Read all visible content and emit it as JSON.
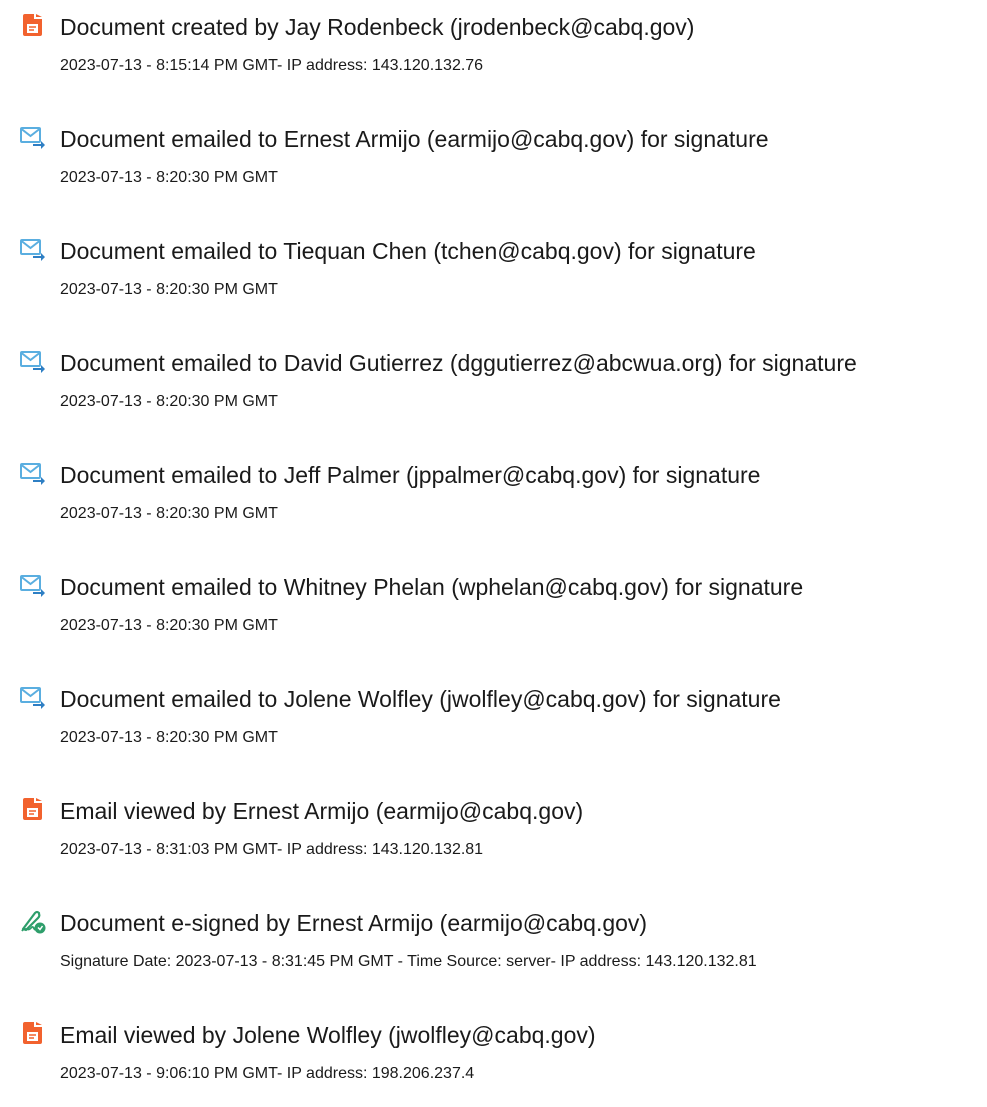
{
  "colors": {
    "created_icon": "#f2622e",
    "email_icon": "#5aaee0",
    "sign_icon": "#2e9e6b",
    "text": "#1a1a1a"
  },
  "events": [
    {
      "icon": "document-created-icon",
      "title": "Document created by Jay Rodenbeck (jrodenbeck@cabq.gov)",
      "detail": "2023-07-13 - 8:15:14 PM GMT- IP address: 143.120.132.76"
    },
    {
      "icon": "email-sent-icon",
      "title": "Document emailed to Ernest Armijo (earmijo@cabq.gov) for signature",
      "detail": "2023-07-13 - 8:20:30 PM GMT"
    },
    {
      "icon": "email-sent-icon",
      "title": "Document emailed to Tiequan Chen (tchen@cabq.gov) for signature",
      "detail": "2023-07-13 - 8:20:30 PM GMT"
    },
    {
      "icon": "email-sent-icon",
      "title": "Document emailed to David Gutierrez (dggutierrez@abcwua.org) for signature",
      "detail": "2023-07-13 - 8:20:30 PM GMT"
    },
    {
      "icon": "email-sent-icon",
      "title": "Document emailed to Jeff Palmer (jppalmer@cabq.gov) for signature",
      "detail": "2023-07-13 - 8:20:30 PM GMT"
    },
    {
      "icon": "email-sent-icon",
      "title": "Document emailed to Whitney Phelan (wphelan@cabq.gov) for signature",
      "detail": "2023-07-13 - 8:20:30 PM GMT"
    },
    {
      "icon": "email-sent-icon",
      "title": "Document emailed to Jolene Wolfley (jwolfley@cabq.gov) for signature",
      "detail": "2023-07-13 - 8:20:30 PM GMT"
    },
    {
      "icon": "document-viewed-icon",
      "title": "Email viewed by Ernest Armijo (earmijo@cabq.gov)",
      "detail": "2023-07-13 - 8:31:03 PM GMT- IP address: 143.120.132.81"
    },
    {
      "icon": "e-sign-icon",
      "title": "Document e-signed by Ernest Armijo (earmijo@cabq.gov)",
      "detail": "Signature Date: 2023-07-13 - 8:31:45 PM GMT - Time Source: server- IP address: 143.120.132.81"
    },
    {
      "icon": "document-viewed-icon",
      "title": "Email viewed by Jolene Wolfley (jwolfley@cabq.gov)",
      "detail": "2023-07-13 - 9:06:10 PM GMT- IP address: 198.206.237.4"
    }
  ]
}
